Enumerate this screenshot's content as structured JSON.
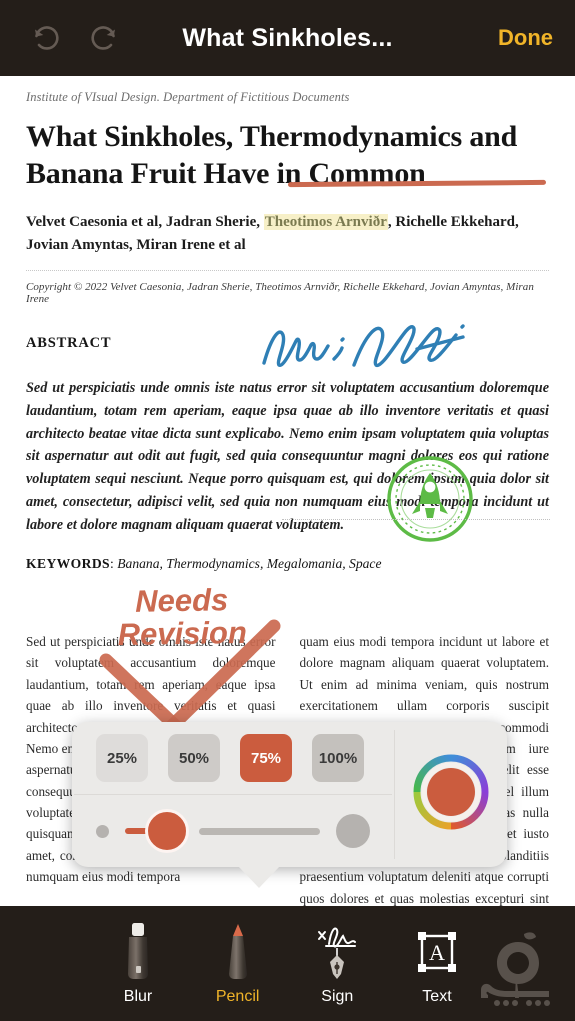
{
  "topbar": {
    "undo_icon": "undo-arrow-icon",
    "redo_icon": "redo-arrow-icon",
    "title": "What Sinkholes...",
    "done_label": "Done",
    "done_color": "#f0b429",
    "background": "#241e19"
  },
  "document": {
    "institute": "Institute of VIsual Design. Department of Fictitious Documents",
    "title_line1": "What Sinkholes, Thermodynamics and",
    "title_line2": "Banana Fruit Have in Common",
    "underline_annotation_color": "#cb6a50",
    "authors_pre": "Velvet Caesonia et al, Jadran Sherie, ",
    "authors_highlighted": "Theotimos Arnviðr",
    "authors_post": ", Richelle Ekkehard, Jovian Amyntas, Miran Irene et al",
    "highlight_color": "#f7f0c8",
    "copyright": "Copyright © 2022 Velvet Caesonia, Jadran Sherie, Theotimos Arnviðr, Richelle Ekkehard, Jovian Amyntas, Miran Irene",
    "abstract_heading": "ABSTRACT",
    "signature_name": "signature-scribble",
    "signature_color": "#2f7fb5",
    "abstract_body": "Sed ut perspiciatis unde omnis iste natus error sit voluptatem accusantium doloremque laudantium, totam rem aperiam, eaque ipsa quae ab illo inventore veritatis et quasi architecto beatae vitae dicta sunt explicabo. Nemo enim ipsam voluptatem quia voluptas sit aspernatur aut odit aut fugit, sed quia consequuntur magni dolores eos qui ratione voluptatem sequi nesciunt. Neque porro quisquam est, qui dolorem ipsum quia dolor sit amet, consectetur, adipisci velit, sed quia non numquam eius modi tempora incidunt ut labore et dolore magnam aliquam quaerat voluptatem.",
    "keywords_label": "KEYWORDS",
    "keywords_value": "Banana, Thermodynamics, Megalomania, Space",
    "stamp_name": "rocket-stamp-icon",
    "stamp_color": "#5dbb46",
    "column_left": "Sed ut perspiciatis unde omnis iste natus error sit voluptatem accusantium doloremque laudantium, totam rem aperiam, eaque ipsa quae ab illo inventore veritatis et quasi architecto beatae vitae dicta sunt explicabo. Nemo enim ipsam voluptatem quia voluptas sit aspernatur aut odit aut fugit, sed quia consequuntur magni dolores eos qui ratione voluptatem sequi nesciunt. Neque porro quisquam est, qui dolorem ipsum quia dolor sit amet, consectetur, adipisci velit, sed quia non numquam eius modi tempora",
    "column_right": "quam eius modi tempora incidunt ut labore et dolore magnam aliquam quaerat voluptatem. Ut enim ad minima veniam, quis nostrum exercitationem ullam corporis suscipit laboriosam, nisi ut aliquid ex ea commodi consequatur? Quis autem vel eum iure reprehenderit qui in ea voluptate velit esse quam nihil molestiae consequatur, vel illum qui dolorem eum fugiat quo voluptas nulla pariatur? At vero eos et accusamus et iusto odio dignissimos ducimus qui blanditiis praesentium voluptatum deleniti atque corrupti quos dolores et quas molestias excepturi sint occaecati cupid-"
  },
  "annotation": {
    "text_line1": "Needs",
    "text_line2": "Revision",
    "color": "#cb6a50",
    "cross_name": "cross-out-mark"
  },
  "popup": {
    "sizes": [
      {
        "label": "25%",
        "active": false
      },
      {
        "label": "50%",
        "active": false
      },
      {
        "label": "75%",
        "active": true
      },
      {
        "label": "100%",
        "active": false
      }
    ],
    "active_color": "#cb5c3e",
    "slider": {
      "name": "brush-size-slider",
      "min_dot": "small-dot",
      "max_dot": "large-dot",
      "knob_color": "#cb5c3e",
      "value_fraction": 0.12
    },
    "color_picker": {
      "name": "color-wheel-picker",
      "selected_color": "#cb5c3e"
    }
  },
  "bottombar": {
    "tools": [
      {
        "label": "Blur",
        "icon": "blur-marker-icon",
        "active": false
      },
      {
        "label": "Pencil",
        "icon": "pencil-icon",
        "active": true
      },
      {
        "label": "Sign",
        "icon": "signature-pen-icon",
        "active": false
      },
      {
        "label": "Text",
        "icon": "text-box-icon",
        "active": false
      }
    ],
    "active_color": "#f0b429",
    "watermark": "soft98-logo-watermark"
  }
}
